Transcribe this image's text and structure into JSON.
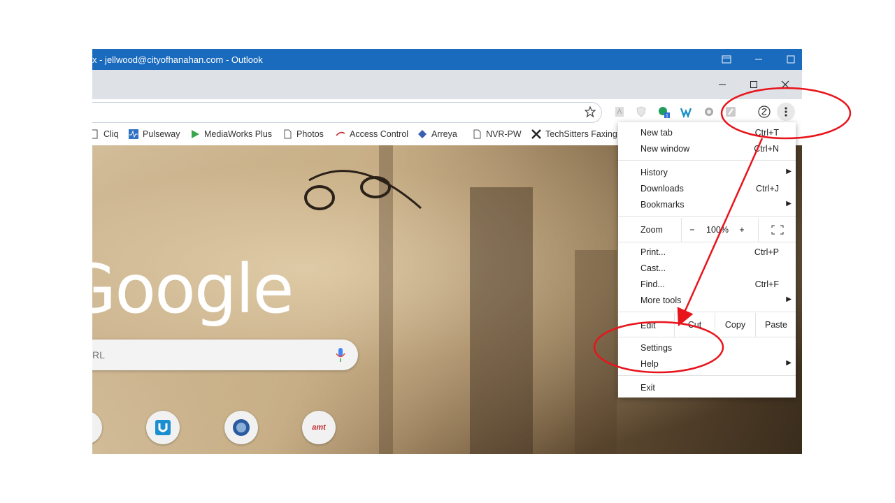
{
  "outlook": {
    "title": "x - jellwood@cityofhanahan.com - Outlook"
  },
  "bookmarks": [
    {
      "label": "Cliq"
    },
    {
      "label": "Pulseway"
    },
    {
      "label": "MediaWorks Plus"
    },
    {
      "label": "Photos"
    },
    {
      "label": "Access Control"
    },
    {
      "label": "Arreya"
    },
    {
      "label": "NVR-PW"
    },
    {
      "label": "TechSitters Faxing"
    }
  ],
  "ntp": {
    "logo_text": "Google",
    "search_placeholder": "RL",
    "shortcut_label": "amt"
  },
  "extensions": {
    "badge": "1"
  },
  "menu": {
    "new_tab": {
      "label": "New tab",
      "shortcut": "Ctrl+T"
    },
    "new_window": {
      "label": "New window",
      "shortcut": "Ctrl+N"
    },
    "history": {
      "label": "History"
    },
    "downloads": {
      "label": "Downloads",
      "shortcut": "Ctrl+J"
    },
    "bookmarks": {
      "label": "Bookmarks"
    },
    "zoom": {
      "label": "Zoom",
      "minus": "−",
      "value": "100%",
      "plus": "+"
    },
    "print": {
      "label": "Print...",
      "shortcut": "Ctrl+P"
    },
    "cast": {
      "label": "Cast..."
    },
    "find": {
      "label": "Find...",
      "shortcut": "Ctrl+F"
    },
    "more_tools": {
      "label": "More tools"
    },
    "edit": {
      "label": "Edit",
      "cut": "Cut",
      "copy": "Copy",
      "paste": "Paste"
    },
    "settings": {
      "label": "Settings"
    },
    "help": {
      "label": "Help"
    },
    "exit": {
      "label": "Exit"
    }
  },
  "colors": {
    "annotation": "#e8141c",
    "outlook_bar": "#1a6bbd",
    "tabstrip": "#dee1e6"
  }
}
